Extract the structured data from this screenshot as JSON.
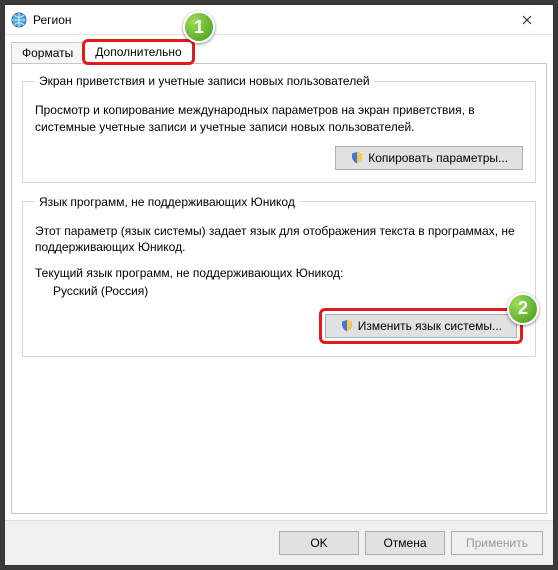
{
  "window": {
    "title": "Регион"
  },
  "tabs": {
    "formats": "Форматы",
    "advanced": "Дополнительно"
  },
  "group1": {
    "legend": "Экран приветствия и учетные записи новых пользователей",
    "desc": "Просмотр и копирование международных параметров на экран приветствия, в системные учетные записи и учетные записи новых пользователей.",
    "copy_btn": "Копировать параметры..."
  },
  "group2": {
    "legend": "Язык программ, не поддерживающих Юникод",
    "desc": "Этот параметр (язык системы) задает язык для отображения текста в программах, не поддерживающих Юникод.",
    "current_label": "Текущий язык программ, не поддерживающих Юникод:",
    "current_value": "Русский (Россия)",
    "change_btn": "Изменить язык системы..."
  },
  "footer": {
    "ok": "OK",
    "cancel": "Отмена",
    "apply": "Применить"
  },
  "callouts": {
    "one": "1",
    "two": "2"
  }
}
